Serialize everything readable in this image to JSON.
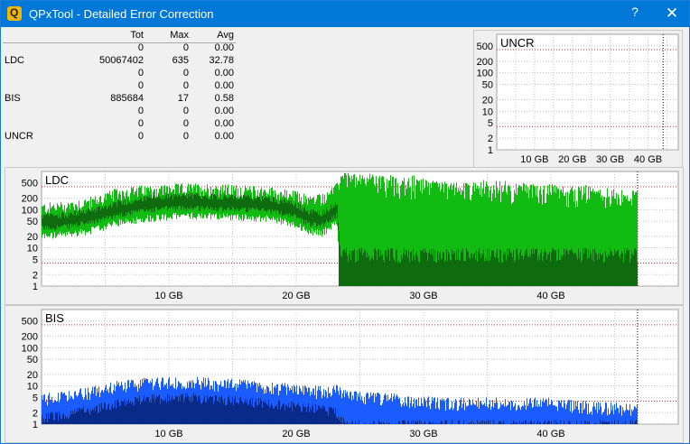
{
  "window": {
    "title": "QPxTool - Detailed Error Correction",
    "help_label": "?",
    "close_label": "✕",
    "app_icon_letter": "Q"
  },
  "stats": {
    "headers": [
      "",
      "Tot",
      "Max",
      "Avg"
    ],
    "rows": [
      [
        "",
        "0",
        "0",
        "0.00"
      ],
      [
        "LDC",
        "50067402",
        "635",
        "32.78"
      ],
      [
        "",
        "0",
        "0",
        "0.00"
      ],
      [
        "",
        "0",
        "0",
        "0.00"
      ],
      [
        "BIS",
        "885684",
        "17",
        "0.58"
      ],
      [
        "",
        "0",
        "0",
        "0.00"
      ],
      [
        "",
        "0",
        "0",
        "0.00"
      ],
      [
        "UNCR",
        "0",
        "0",
        "0.00"
      ]
    ]
  },
  "chart_data": [
    {
      "type": "bar",
      "title": "UNCR",
      "yticks": [
        "500",
        "200",
        "100",
        "50",
        "20",
        "10",
        "5",
        "2",
        "1"
      ],
      "xticks": [
        "10 GB",
        "20 GB",
        "30 GB",
        "40 GB"
      ],
      "x_unit": "GB",
      "xlim": [
        0,
        48
      ],
      "ylim": [
        1,
        1000
      ],
      "y_scale": "log",
      "values": [],
      "colors": {
        "red_grid": "#cc3333",
        "grid": "#b8b8b8"
      }
    },
    {
      "type": "area",
      "title": "LDC",
      "yticks": [
        "500",
        "200",
        "100",
        "50",
        "20",
        "10",
        "5",
        "2",
        "1"
      ],
      "xticks": [
        "10 GB",
        "20 GB",
        "30 GB",
        "40 GB"
      ],
      "x_unit": "GB",
      "xlim": [
        0,
        50
      ],
      "ylim": [
        1,
        1000
      ],
      "y_scale": "log",
      "series": [
        {
          "x": [
            0,
            2,
            4,
            6,
            8,
            10,
            12,
            14,
            16,
            18,
            20,
            21,
            22,
            23.2,
            23.5,
            26,
            30,
            34,
            38,
            42,
            46.8
          ],
          "max_values": [
            120,
            140,
            180,
            300,
            350,
            380,
            400,
            380,
            350,
            320,
            250,
            200,
            220,
            400,
            500,
            400,
            300,
            250,
            220,
            200,
            150
          ],
          "avg_values": [
            45,
            50,
            65,
            100,
            130,
            150,
            155,
            150,
            140,
            130,
            90,
            60,
            55,
            100,
            4,
            4,
            4,
            4,
            4,
            4,
            4
          ]
        }
      ],
      "colors": {
        "max": "#11bb11",
        "avg": "#0e6b0e",
        "red_grid": "#cc3333"
      }
    },
    {
      "type": "area",
      "title": "BIS",
      "yticks": [
        "500",
        "200",
        "100",
        "50",
        "20",
        "10",
        "5",
        "2",
        "1"
      ],
      "xticks": [
        "10 GB",
        "20 GB",
        "30 GB",
        "40 GB"
      ],
      "x_unit": "GB",
      "xlim": [
        0,
        50
      ],
      "ylim": [
        1,
        1000
      ],
      "y_scale": "log",
      "series": [
        {
          "x": [
            0,
            2,
            4,
            6,
            8,
            10,
            12,
            14,
            16,
            18,
            20,
            22,
            23.2,
            24,
            28,
            32,
            36,
            40,
            44,
            46.8
          ],
          "max_values": [
            5,
            6,
            8,
            11,
            13,
            14,
            14,
            13,
            12,
            11,
            9,
            8,
            9,
            6,
            5,
            4,
            4,
            4,
            3,
            3
          ],
          "avg_values": [
            1.5,
            1.8,
            2.5,
            3.5,
            4.5,
            5,
            5,
            4.5,
            4,
            3.5,
            3,
            2.5,
            2,
            1,
            1,
            1,
            1,
            1,
            1,
            1
          ]
        }
      ],
      "colors": {
        "max": "#1a5cff",
        "avg": "#0a2a8a",
        "red_grid": "#cc3333"
      }
    }
  ]
}
